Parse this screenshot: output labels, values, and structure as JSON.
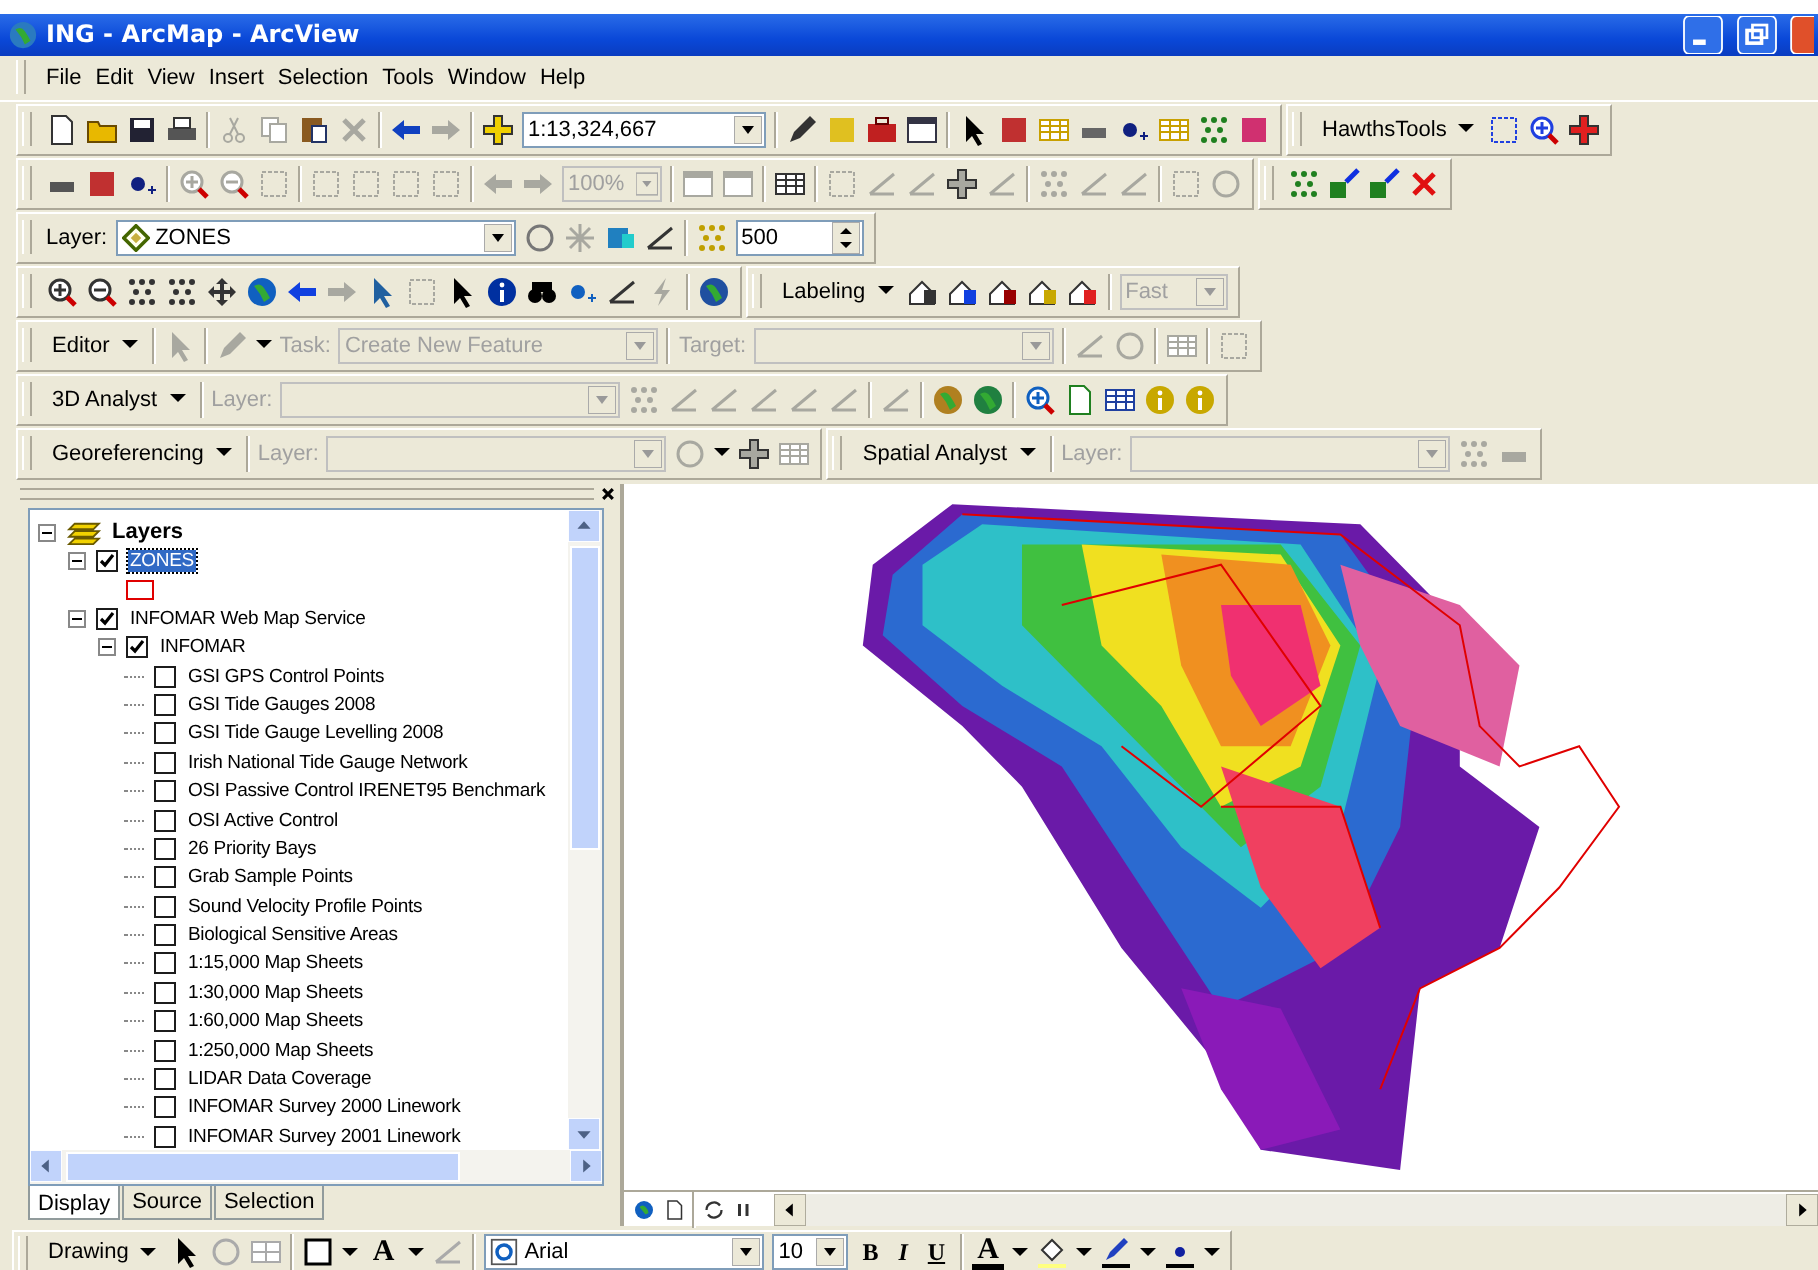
{
  "window": {
    "title": "ING - ArcMap - ArcView"
  },
  "menu": [
    "File",
    "Edit",
    "View",
    "Insert",
    "Selection",
    "Tools",
    "Window",
    "Help"
  ],
  "standard_toolbar": {
    "scale": "1:13,324,667"
  },
  "hawths_toolbar": {
    "label": "HawthsTools"
  },
  "layout_toolbar": {
    "zoom": "100%",
    "disabled": true
  },
  "effects_toolbar": {
    "layer_label": "Layer:",
    "layer": "ZONES",
    "value": "500"
  },
  "labeling_toolbar": {
    "label": "Labeling",
    "quality": "Fast",
    "disabled": true
  },
  "editor_toolbar": {
    "label": "Editor",
    "task_label": "Task:",
    "task": "Create New Feature",
    "target_label": "Target:",
    "disabled": true
  },
  "analyst_3d_toolbar": {
    "label": "3D Analyst",
    "layer_label": "Layer:",
    "disabled": true
  },
  "georef_toolbar": {
    "label": "Georeferencing",
    "layer_label": "Layer:",
    "disabled": true
  },
  "spatial_analyst_toolbar": {
    "label": "Spatial Analyst",
    "layer_label": "Layer:",
    "disabled": true
  },
  "toc": {
    "root": "Layers",
    "layers": [
      {
        "label": "ZONES",
        "checked": true,
        "selected": true,
        "expanded": true
      },
      {
        "label": "INFOMAR Web Map Service",
        "checked": true,
        "selected": false,
        "expanded": true,
        "children": [
          {
            "label": "INFOMAR",
            "checked": true,
            "selected": false,
            "expanded": true,
            "children": [
              {
                "label": "GSI GPS Control Points",
                "checked": false,
                "selected": false
              },
              {
                "label": "GSI Tide Gauges 2008",
                "checked": false,
                "selected": false
              },
              {
                "label": "GSI Tide Gauge Levelling 2008",
                "checked": false,
                "selected": false
              },
              {
                "label": "Irish National Tide Gauge Network",
                "checked": false,
                "selected": false
              },
              {
                "label": "OSI Passive Control IRENET95 Benchmark",
                "checked": false,
                "selected": false
              },
              {
                "label": "OSI Active Control",
                "checked": false,
                "selected": false
              },
              {
                "label": "26 Priority Bays",
                "checked": false,
                "selected": false
              },
              {
                "label": "Grab Sample Points",
                "checked": false,
                "selected": false
              },
              {
                "label": "Sound Velocity Profile Points",
                "checked": false,
                "selected": false
              },
              {
                "label": "Biological Sensitive Areas",
                "checked": false,
                "selected": false
              },
              {
                "label": "1:15,000 Map Sheets",
                "checked": false,
                "selected": false
              },
              {
                "label": "1:30,000 Map Sheets",
                "checked": false,
                "selected": false
              },
              {
                "label": "1:60,000 Map Sheets",
                "checked": false,
                "selected": false
              },
              {
                "label": "1:250,000 Map Sheets",
                "checked": false,
                "selected": false
              },
              {
                "label": "LIDAR Data Coverage",
                "checked": false,
                "selected": false
              },
              {
                "label": "INFOMAR Survey 2000 Linework",
                "checked": false,
                "selected": false
              },
              {
                "label": "INFOMAR Survey 2001 Linework",
                "checked": false,
                "selected": false
              }
            ]
          }
        ]
      }
    ]
  },
  "toc_tabs": [
    {
      "label": "Display",
      "selected": true
    },
    {
      "label": "Source",
      "selected": false
    },
    {
      "label": "Selection",
      "selected": false
    }
  ],
  "drawing_toolbar": {
    "label": "Drawing",
    "text_tool": "A",
    "font": "Arial",
    "size": "10",
    "format_buttons": [
      "B",
      "I",
      "U"
    ],
    "font_color": "A"
  }
}
